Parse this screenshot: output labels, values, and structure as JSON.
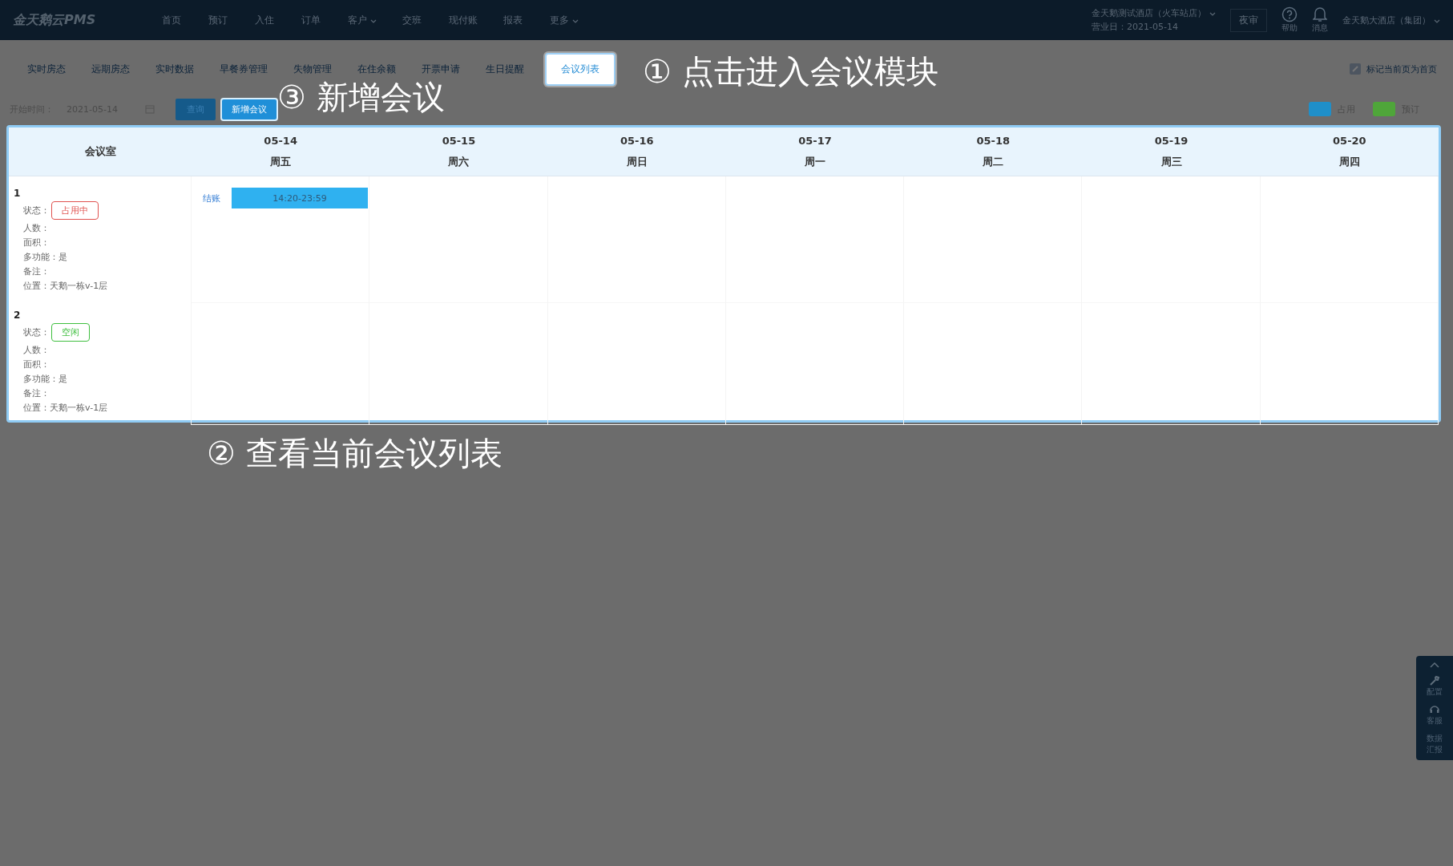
{
  "app": {
    "logo": "金天鹅云PMS"
  },
  "nav": [
    {
      "label": "首页",
      "dropdown": false
    },
    {
      "label": "预订",
      "dropdown": false
    },
    {
      "label": "入住",
      "dropdown": false
    },
    {
      "label": "订单",
      "dropdown": false
    },
    {
      "label": "客户",
      "dropdown": true
    },
    {
      "label": "交班",
      "dropdown": false
    },
    {
      "label": "现付账",
      "dropdown": false
    },
    {
      "label": "报表",
      "dropdown": false
    },
    {
      "label": "更多",
      "dropdown": true
    }
  ],
  "header_right": {
    "hotel": "金天鹅测试酒店（火车站店）",
    "business_day": "营业日：2021-05-14",
    "night_audit": "夜审",
    "help": "帮助",
    "messages": "消息",
    "group": "金天鹅大酒店（集团）"
  },
  "tabs": [
    {
      "label": "实时房态",
      "selected": false
    },
    {
      "label": "远期房态",
      "selected": false
    },
    {
      "label": "实时数据",
      "selected": false
    },
    {
      "label": "早餐券管理",
      "selected": false
    },
    {
      "label": "失物管理",
      "selected": false
    },
    {
      "label": "在住余额",
      "selected": false
    },
    {
      "label": "开票申请",
      "selected": false
    },
    {
      "label": "生日提醒",
      "selected": false
    },
    {
      "label": "会议列表",
      "selected": true
    }
  ],
  "set_home": "标记当前页为首页",
  "filter": {
    "label": "开始时间：",
    "date": "2021-05-14",
    "query": "查询",
    "add": "新增会议"
  },
  "legend": [
    {
      "label": "占用",
      "color": "#1f8fc9"
    },
    {
      "label": "预订",
      "color": "#4fa63a"
    }
  ],
  "annotations": [
    {
      "mark": "①",
      "text": "点击进入会议模块"
    },
    {
      "mark": "③",
      "text": "新增会议"
    },
    {
      "mark": "②",
      "text": "查看当前会议列表"
    }
  ],
  "table": {
    "room_header": "会议室",
    "days": [
      {
        "date": "05-14",
        "weekday": "周五"
      },
      {
        "date": "05-15",
        "weekday": "周六"
      },
      {
        "date": "05-16",
        "weekday": "周日"
      },
      {
        "date": "05-17",
        "weekday": "周一"
      },
      {
        "date": "05-18",
        "weekday": "周二"
      },
      {
        "date": "05-19",
        "weekday": "周三"
      },
      {
        "date": "05-20",
        "weekday": "周四"
      }
    ],
    "rooms": [
      {
        "name": "1",
        "status_label": "状态：",
        "status": {
          "label": "占用中",
          "color": "#e0524f"
        },
        "details": [
          "人数：",
          "面积：",
          "多功能：是",
          "备注：",
          "位置：天鹅一栋v-1层"
        ],
        "schedule": [
          {
            "action": "结账",
            "time": "14:20-23:59"
          }
        ]
      },
      {
        "name": "2",
        "status_label": "状态：",
        "status": {
          "label": "空闲",
          "color": "#3fbf3f"
        },
        "details": [
          "人数：",
          "面积：",
          "多功能：是",
          "备注：",
          "位置：天鹅一栋v-1层"
        ]
      }
    ]
  },
  "side_tools": {
    "items": [
      "配置",
      "客服",
      "数据汇报"
    ]
  }
}
